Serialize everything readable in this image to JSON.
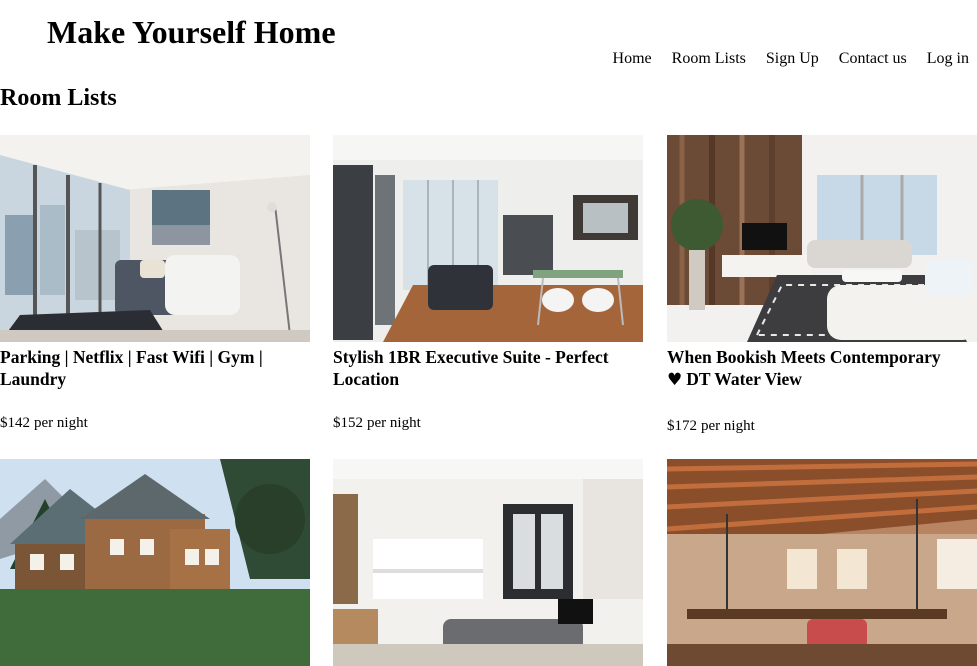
{
  "site": {
    "title": "Make Yourself Home"
  },
  "nav": {
    "items": [
      "Home",
      "Room Lists",
      "Sign Up",
      "Contact us",
      "Log in"
    ]
  },
  "page": {
    "section_title": "Room Lists"
  },
  "listings": [
    {
      "title": "Parking | Netflix | Fast Wifi | Gym | Laundry",
      "price": "$142",
      "unit": "per night",
      "heart_icon": false,
      "image": "condo-living-room-window-view"
    },
    {
      "title": "Stylish 1BR Executive Suite - Perfect Location",
      "price": "$152",
      "unit": "per night",
      "heart_icon": false,
      "image": "open-kitchen-living-room"
    },
    {
      "title": "DT Water View",
      "title_prefix": "When Bookish Meets Contemporary",
      "price": "$172",
      "unit": "per night",
      "heart_icon": true,
      "image": "wood-wall-living-room"
    },
    {
      "title": "",
      "price": "",
      "unit": "",
      "heart_icon": false,
      "image": "mountain-lodge-exterior"
    },
    {
      "title": "",
      "price": "",
      "unit": "",
      "heart_icon": false,
      "image": "white-modern-loft"
    },
    {
      "title": "",
      "price": "",
      "unit": "",
      "heart_icon": false,
      "image": "brick-loft-wood-ceiling"
    }
  ]
}
